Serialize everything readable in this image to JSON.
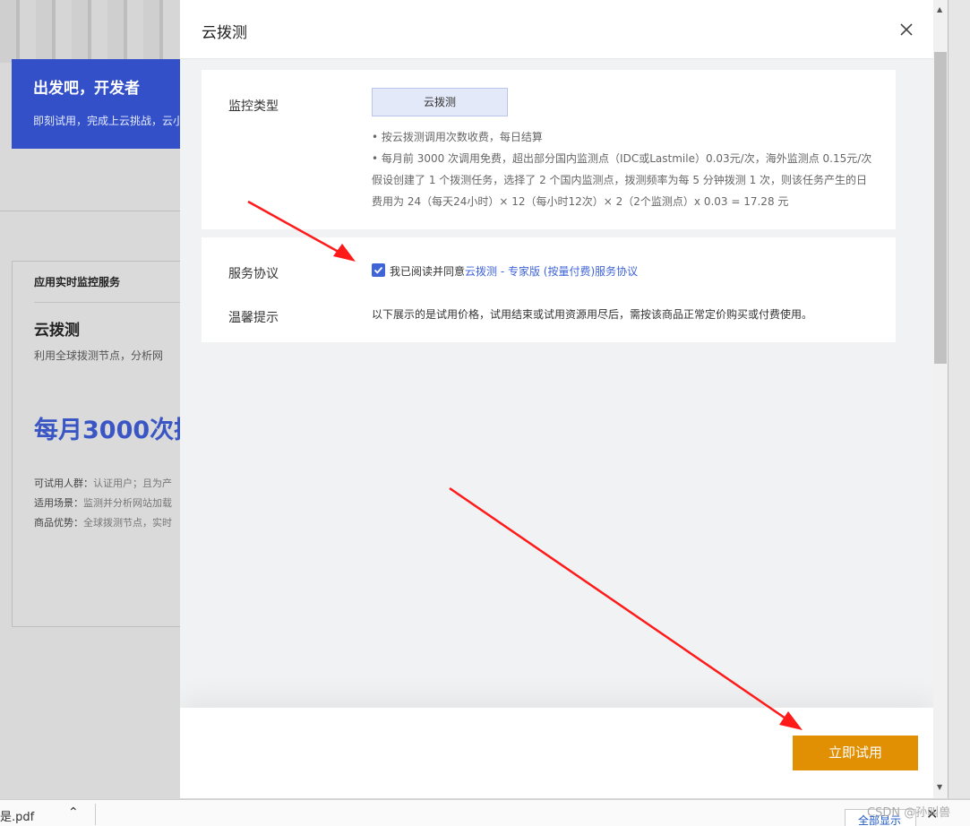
{
  "background": {
    "hero_title": "出发吧，开发者",
    "hero_subtitle": "即刻试用，完成上云挑战，云小",
    "card": {
      "category": "应用实时监控服务",
      "title": "云拨测",
      "description": "利用全球拨测节点，分析网",
      "promo": "每月3000次拨",
      "meta": [
        {
          "label": "可试用人群：",
          "value": "认证用户；且为产"
        },
        {
          "label": "适用场景：",
          "value": "监测并分析网站加载"
        },
        {
          "label": "商品优势：",
          "value": "全球拨测节点，实时"
        }
      ]
    }
  },
  "drawer": {
    "title": "云拨测",
    "close_icon": "close-icon",
    "monitor_type": {
      "label": "监控类型",
      "button": "云拨测",
      "notes": [
        "• 按云拨测调用次数收费，每日结算",
        "• 每月前 3000 次调用免费，超出部分国内监测点（IDC或Lastmile）0.03元/次，海外监测点 0.15元/次",
        "假设创建了 1 个拨测任务，选择了 2 个国内监测点，拨测频率为每 5 分钟拨测 1 次，则该任务产生的日",
        "费用为 24（每天24小时）× 12（每小时12次）× 2（2个监测点）x 0.03 = 17.28 元"
      ]
    },
    "agreement": {
      "label": "服务协议",
      "checked": true,
      "prefix": "我已阅读并同意",
      "link": "云拨测 - 专家版 (按量付费)服务协议"
    },
    "tip": {
      "label": "温馨提示",
      "text": "以下展示的是试用价格，试用结束或试用资源用尽后，需按该商品正常定价购买或付费使用。"
    },
    "trial_button": "立即试用"
  },
  "download_bar": {
    "file": "是.pdf",
    "show_all": "全部显示"
  },
  "watermark": "CSDN @孙叫兽",
  "colors": {
    "accent_blue": "#3f64d7",
    "trial_orange": "#e18f03",
    "arrow_red": "#ff1a1a"
  }
}
